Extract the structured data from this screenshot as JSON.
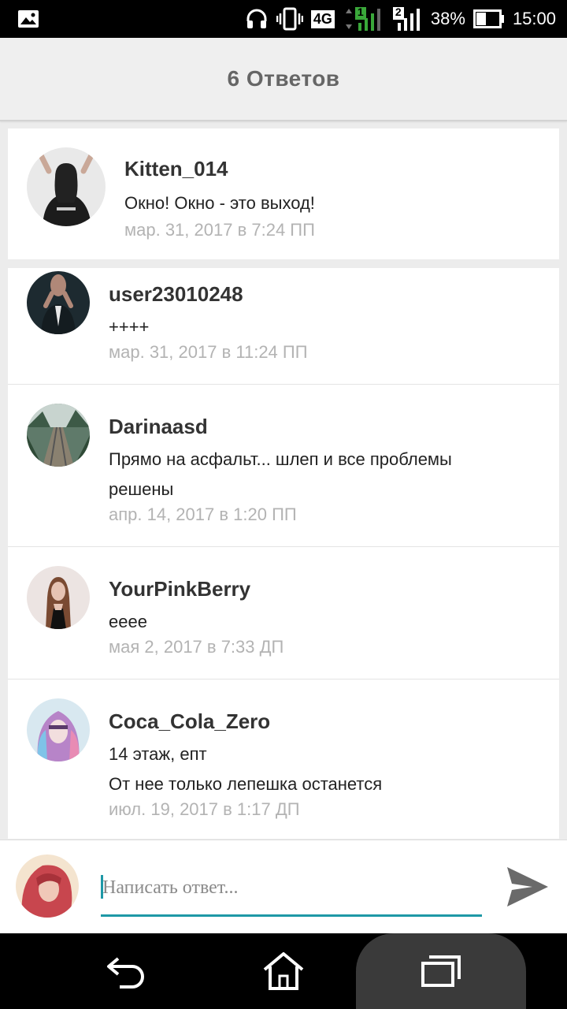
{
  "status_bar": {
    "network": "4G",
    "sim1": "1",
    "sim2": "2",
    "battery": "38%",
    "time": "15:00"
  },
  "header": {
    "title": "6 Ответов"
  },
  "original_post": {
    "username": "Kitten_014",
    "text": "Окно! Окно - это выход!",
    "date": "мар. 31, 2017 в 7:24 ПП"
  },
  "replies": [
    {
      "username": "user23010248",
      "text": "++++",
      "date": "мар. 31, 2017 в 11:24 ПП"
    },
    {
      "username": "Darinaasd",
      "text": "Прямо на асфальт... шлеп и все проблемы решены",
      "date": "апр. 14, 2017 в 1:20 ПП"
    },
    {
      "username": "YourPinkBerry",
      "text": "eeee",
      "date": "мая 2, 2017 в 7:33 ДП"
    },
    {
      "username": "Coca_Cola_Zero",
      "text": "14 этаж, епт\nОт нее только лепешка останется",
      "date": "июл. 19, 2017 в 1:17 ДП"
    }
  ],
  "composer": {
    "placeholder": "Написать ответ..."
  },
  "colors": {
    "accent": "#1e98a6",
    "date": "#b3b3b3",
    "header_bg": "#efefef"
  },
  "icons": [
    "image-icon",
    "headphones-icon",
    "vibrate-icon",
    "signal-icon",
    "battery-icon",
    "send-icon",
    "back-icon",
    "home-icon",
    "recents-icon"
  ]
}
